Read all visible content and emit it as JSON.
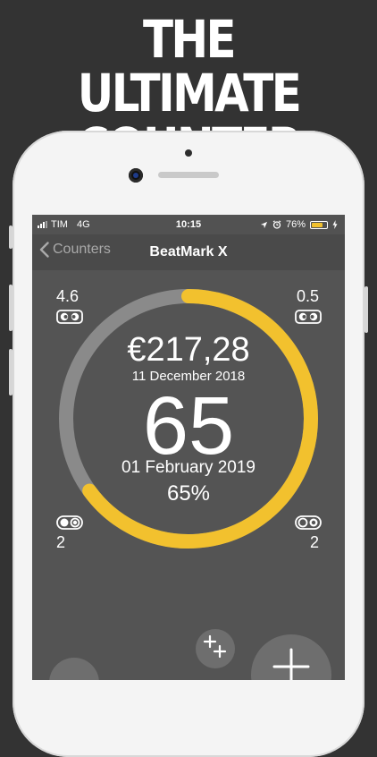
{
  "headline": {
    "line1": "THE ULTIMATE",
    "line2": "COUNTER"
  },
  "status_bar": {
    "carrier": "TIM",
    "network": "4G",
    "time": "10:15",
    "battery": "76%",
    "battery_level": 0.76
  },
  "nav": {
    "back_label": "Counters",
    "title": "BeatMark X"
  },
  "counter": {
    "amount": "€217,28",
    "start_date": "11 December 2018",
    "value": "65",
    "end_date": "01 February 2019",
    "percent": "65%",
    "progress": 0.65
  },
  "corners": {
    "top_left_value": "4.6",
    "top_right_value": "0.5",
    "bottom_left_value": "2",
    "bottom_right_value": "2"
  },
  "colors": {
    "accent": "#F2C12E",
    "track": "#8A8A8A",
    "screen": "#545454"
  },
  "icons": {
    "top_left": "speed-glasses-icon",
    "top_right": "speed-glasses-icon",
    "bottom_left": "step-toggle-icon",
    "bottom_right": "step-toggle-icon",
    "multi_add": "multi-plus-icon",
    "add": "plus-icon"
  }
}
